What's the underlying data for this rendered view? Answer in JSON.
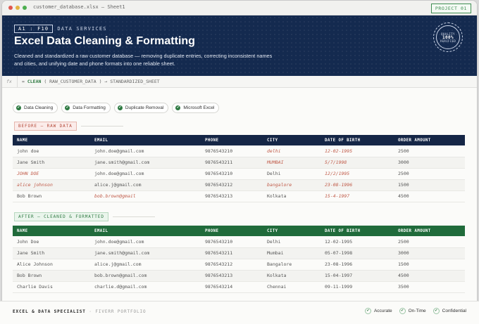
{
  "window": {
    "title": "customer_database.xlsx — Sheet1",
    "project_badge": "PROJECT 01"
  },
  "hero": {
    "cell_ref": "A1 : F10",
    "tag": "DATA SERVICES",
    "title": "Excel Data Cleaning & Formatting",
    "description": "Cleaned and standardized a raw customer database — removing duplicate entries, correcting inconsistent names and cities, and unifying date and phone formats into one reliable sheet.",
    "seal": {
      "top": "QUALITY",
      "middle": "100%",
      "bottom": "VERIFIED"
    }
  },
  "formula_bar": {
    "fx": "fx",
    "prefix": "= ",
    "func": "CLEAN",
    "args": " ( RAW_CUSTOMER_DATA ) → STANDARDIZED_SHEET"
  },
  "chips": [
    "Data Cleaning",
    "Data Formatting",
    "Duplicate Removal",
    "Microsoft Excel"
  ],
  "before": {
    "label": "BEFORE — RAW DATA",
    "headers": [
      "NAME",
      "EMAIL",
      "PHONE",
      "CITY",
      "DATE OF BIRTH",
      "ORDER AMOUNT"
    ],
    "rows": [
      {
        "cells": [
          "john doe",
          "john.doe@gmail.com",
          "9876543210",
          "delhi",
          "12-02-1995",
          "2500"
        ],
        "errors": [
          3,
          4
        ]
      },
      {
        "cells": [
          "Jane Smith",
          "jane.smith@gmail.com",
          "9876543211",
          "MUMBAI",
          "5/7/1998",
          "3000"
        ],
        "errors": [
          3,
          4
        ]
      },
      {
        "cells": [
          "JOHN DOE",
          "john.doe@gmail.com",
          "9876543210",
          "Delhi",
          "12/2/1995",
          "2500"
        ],
        "errors": [
          0,
          4
        ]
      },
      {
        "cells": [
          "alice johnson",
          "alice.j@gmail.com",
          "9876543212",
          "bangalore",
          "23-08-1996",
          "1500"
        ],
        "errors": [
          0,
          3,
          4
        ]
      },
      {
        "cells": [
          "Bob Brown",
          "bob.brown@gmail",
          "9876543213",
          "Kolkata",
          "15-4-1997",
          "4500"
        ],
        "errors": [
          1,
          4
        ]
      }
    ]
  },
  "after": {
    "label": "AFTER — CLEANED & FORMATTED",
    "headers": [
      "NAME",
      "EMAIL",
      "PHONE",
      "CITY",
      "DATE OF BIRTH",
      "ORDER AMOUNT"
    ],
    "rows": [
      [
        "John Doe",
        "john.doe@gmail.com",
        "9876543210",
        "Delhi",
        "12-02-1995",
        "2500"
      ],
      [
        "Jane Smith",
        "jane.smith@gmail.com",
        "9876543211",
        "Mumbai",
        "05-07-1998",
        "3000"
      ],
      [
        "Alice Johnson",
        "alice.j@gmail.com",
        "9876543212",
        "Bangalore",
        "23-08-1996",
        "1500"
      ],
      [
        "Bob Brown",
        "bob.brown@gmail.com",
        "9876543213",
        "Kolkata",
        "15-04-1997",
        "4500"
      ],
      [
        "Charlie Davis",
        "charlie.d@gmail.com",
        "9876543214",
        "Chennai",
        "09-11-1999",
        "3500"
      ]
    ]
  },
  "footer": {
    "title": "EXCEL & DATA SPECIALIST",
    "subtitle": " · FIVERR PORTFOLIO",
    "badges": [
      "Accurate",
      "On-Time",
      "Confidential"
    ]
  },
  "colors": {
    "navy": "#142a4f",
    "green": "#206b3b",
    "error": "#c05a48"
  },
  "icons": {
    "check": "check-icon"
  }
}
